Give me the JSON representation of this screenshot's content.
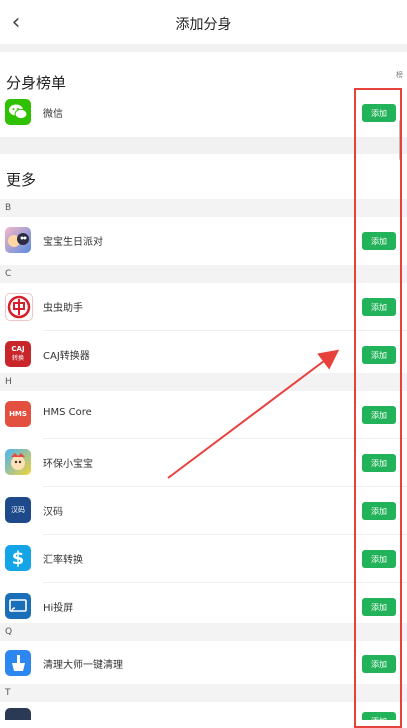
{
  "header": {
    "title": "添加分身"
  },
  "ranking": {
    "title": "分身榜单",
    "items": [
      {
        "label": "微信",
        "button": "添加"
      }
    ]
  },
  "more": {
    "title": "更多",
    "groups": [
      {
        "letter": "B",
        "items": [
          {
            "label": "宝宝生日派对",
            "button": "添加"
          }
        ]
      },
      {
        "letter": "C",
        "items": [
          {
            "label": "虫虫助手",
            "button": "添加"
          },
          {
            "label": "CAJ转换器",
            "button": "添加"
          }
        ]
      },
      {
        "letter": "H",
        "items": [
          {
            "label": "HMS Core",
            "button": "添加"
          },
          {
            "label": "环保小宝宝",
            "button": "添加"
          },
          {
            "label": "汉码",
            "button": "添加"
          },
          {
            "label": "汇率转换",
            "button": "添加"
          },
          {
            "label": "Hi投屏",
            "button": "添加"
          }
        ]
      },
      {
        "letter": "Q",
        "items": [
          {
            "label": "清理大师一键清理",
            "button": "添加"
          }
        ]
      },
      {
        "letter": "T",
        "items": [
          {
            "label": "",
            "button": "添加"
          }
        ]
      }
    ]
  },
  "icons": {
    "wechat": "wechat-icon",
    "baby_party": "baby-birthday-party-icon",
    "chongchong": "chongchong-assistant-icon",
    "caj": "caj-converter-icon",
    "caj_text": "CAJ",
    "caj_sub": "转换",
    "hms": "hms-core-icon",
    "hms_text": "HMS",
    "env_baby": "eco-baby-icon",
    "hanma": "hanma-icon",
    "hanma_text": "汉码",
    "currency": "currency-convert-icon",
    "currency_text": "$",
    "hicast": "hi-cast-icon",
    "cleaner": "cleaner-broom-icon",
    "t_app": "t-app-icon"
  },
  "scroll_index_hint": "榜",
  "colors": {
    "accent": "#22b35a",
    "annotation": "#e8413b"
  }
}
